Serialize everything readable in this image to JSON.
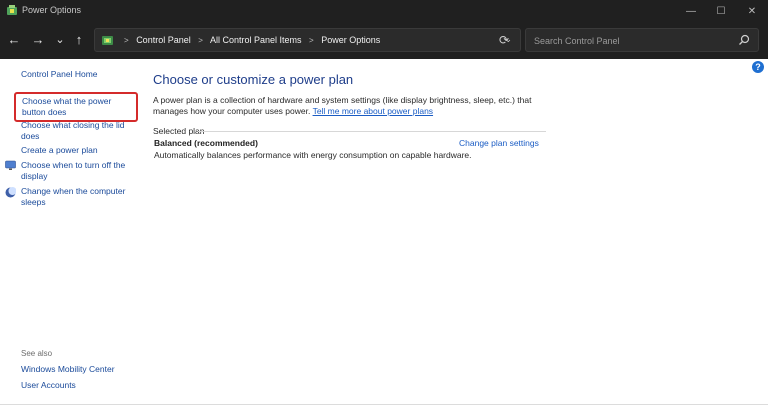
{
  "window": {
    "title": "Power Options",
    "controls": {
      "minimize": "—",
      "maximize": "☐",
      "close": "✕"
    }
  },
  "nav": {
    "back": "←",
    "forward": "→",
    "recent": "⌄",
    "up": "↑",
    "breadcrumbs": [
      "Control Panel",
      "All Control Panel Items",
      "Power Options"
    ],
    "separator": ">",
    "dropdown": "⌄",
    "refresh": "⟳",
    "search_placeholder": "Search Control Panel"
  },
  "sidebar": {
    "home": "Control Panel Home",
    "items": [
      {
        "label": "Choose what the power button does",
        "highlighted": true
      },
      {
        "label": "Choose what closing the lid does"
      },
      {
        "label": "Create a power plan"
      },
      {
        "label": "Choose when to turn off the display",
        "icon": "display-icon"
      },
      {
        "label": "Change when the computer sleeps",
        "icon": "moon-icon"
      }
    ],
    "see_also_label": "See also",
    "see_also": [
      "Windows Mobility Center",
      "User Accounts"
    ]
  },
  "main": {
    "title": "Choose or customize a power plan",
    "description": "A power plan is a collection of hardware and system settings (like display brightness, sleep, etc.) that manages how your computer uses power.",
    "learn_more": "Tell me more about power plans",
    "selected_plan_label": "Selected plan",
    "plan": {
      "name": "Balanced (recommended)",
      "change_link": "Change plan settings",
      "description": "Automatically balances performance with energy consumption on capable hardware."
    }
  },
  "help": "?",
  "colors": {
    "highlight_border": "#d42b2b",
    "link": "#1a4a9a",
    "title": "#1e3d8a",
    "chrome": "#202020"
  }
}
